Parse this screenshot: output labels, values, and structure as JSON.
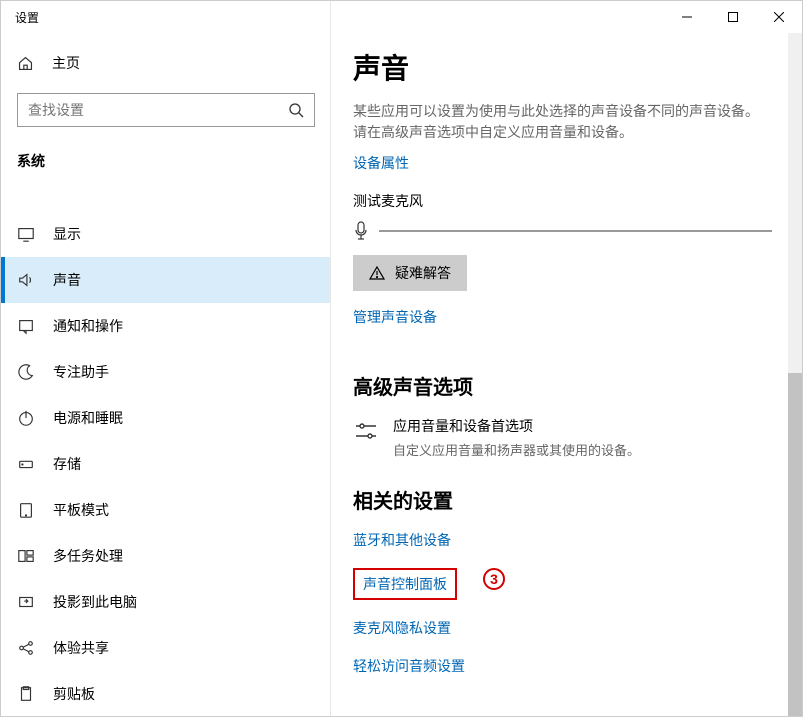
{
  "titlebar": {
    "title": "设置"
  },
  "sidebar": {
    "home": "主页",
    "search_placeholder": "查找设置",
    "category": "系统",
    "items": [
      {
        "label": "显示"
      },
      {
        "label": "声音"
      },
      {
        "label": "通知和操作"
      },
      {
        "label": "专注助手"
      },
      {
        "label": "电源和睡眠"
      },
      {
        "label": "存储"
      },
      {
        "label": "平板模式"
      },
      {
        "label": "多任务处理"
      },
      {
        "label": "投影到此电脑"
      },
      {
        "label": "体验共享"
      },
      {
        "label": "剪贴板"
      }
    ]
  },
  "content": {
    "page_title": "声音",
    "truncated": "某些应用可以设置为使用与此处选择的声音设备不同的声音设备。请在高级声音选项中自定义应用音量和设备。",
    "device_properties": "设备属性",
    "test_mic": "测试麦克风",
    "troubleshoot": "疑难解答",
    "manage_devices": "管理声音设备",
    "advanced_title": "高级声音选项",
    "app_volume_title": "应用音量和设备首选项",
    "app_volume_desc": "自定义应用音量和扬声器或其使用的设备。",
    "related_title": "相关的设置",
    "related_links": {
      "bluetooth": "蓝牙和其他设备",
      "sound_panel": "声音控制面板",
      "mic_privacy": "麦克风隐私设置",
      "ease_access": "轻松访问音频设置"
    }
  },
  "annotation": {
    "num": "3"
  }
}
